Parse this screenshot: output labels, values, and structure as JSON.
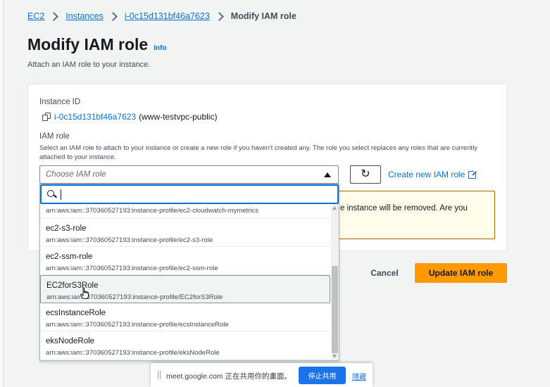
{
  "breadcrumb": {
    "items": [
      "EC2",
      "Instances",
      "i-0c15d131bf46a7623"
    ],
    "current": "Modify IAM role"
  },
  "page": {
    "title": "Modify IAM role",
    "info_link": "Info",
    "description": "Attach an IAM role to your instance."
  },
  "instance": {
    "label": "Instance ID",
    "id": "i-0c15d131bf46a7623",
    "name": "(www-testvpc-public)"
  },
  "iam_role": {
    "label": "IAM role",
    "description": "Select an IAM role to attach to your instance or create a new role if you haven't created any. The role you select replaces any roles that are currently attached to your instance.",
    "placeholder": "Choose IAM role",
    "create_link": "Create new IAM role",
    "filter_value": ""
  },
  "dropdown": {
    "partial_option_arn": "arn:aws:iam::370360527193:instance-profile/ec2-cloudwatch-mymetrics",
    "options": [
      {
        "name": "ec2-s3-role",
        "arn": "arn:aws:iam::370360527193:instance-profile/ec2-s3-role"
      },
      {
        "name": "ec2-ssm-role",
        "arn": "arn:aws:iam::370360527193:instance-profile/ec2-ssm-role"
      },
      {
        "name": "EC2forS3Role",
        "arn": "arn:aws:iam::370360527193:instance-profile/EC2forS3Role",
        "hovered": true
      },
      {
        "name": "ecsInstanceRole",
        "arn": "arn:aws:iam::370360527193:instance-profile/ecsInstanceRole"
      },
      {
        "name": "eksNodeRole",
        "arn": "arn:aws:iam::370360527193:instance-profile/eksNodeRole"
      }
    ]
  },
  "warning": {
    "visible_text": "e instance will be removed. Are you"
  },
  "actions": {
    "cancel": "Cancel",
    "update": "Update IAM role"
  },
  "share_bar": {
    "message": "meet.google.com 正在共用你的畫面。",
    "stop_button": "停止共用",
    "hide_link": "隱藏"
  },
  "colors": {
    "link": "#0972d3",
    "primary_button": "#ff9900",
    "focus_border": "#0972d3",
    "warning_background": "#fffce9",
    "warning_border": "#a16b00",
    "share_button": "#1a73e8"
  }
}
